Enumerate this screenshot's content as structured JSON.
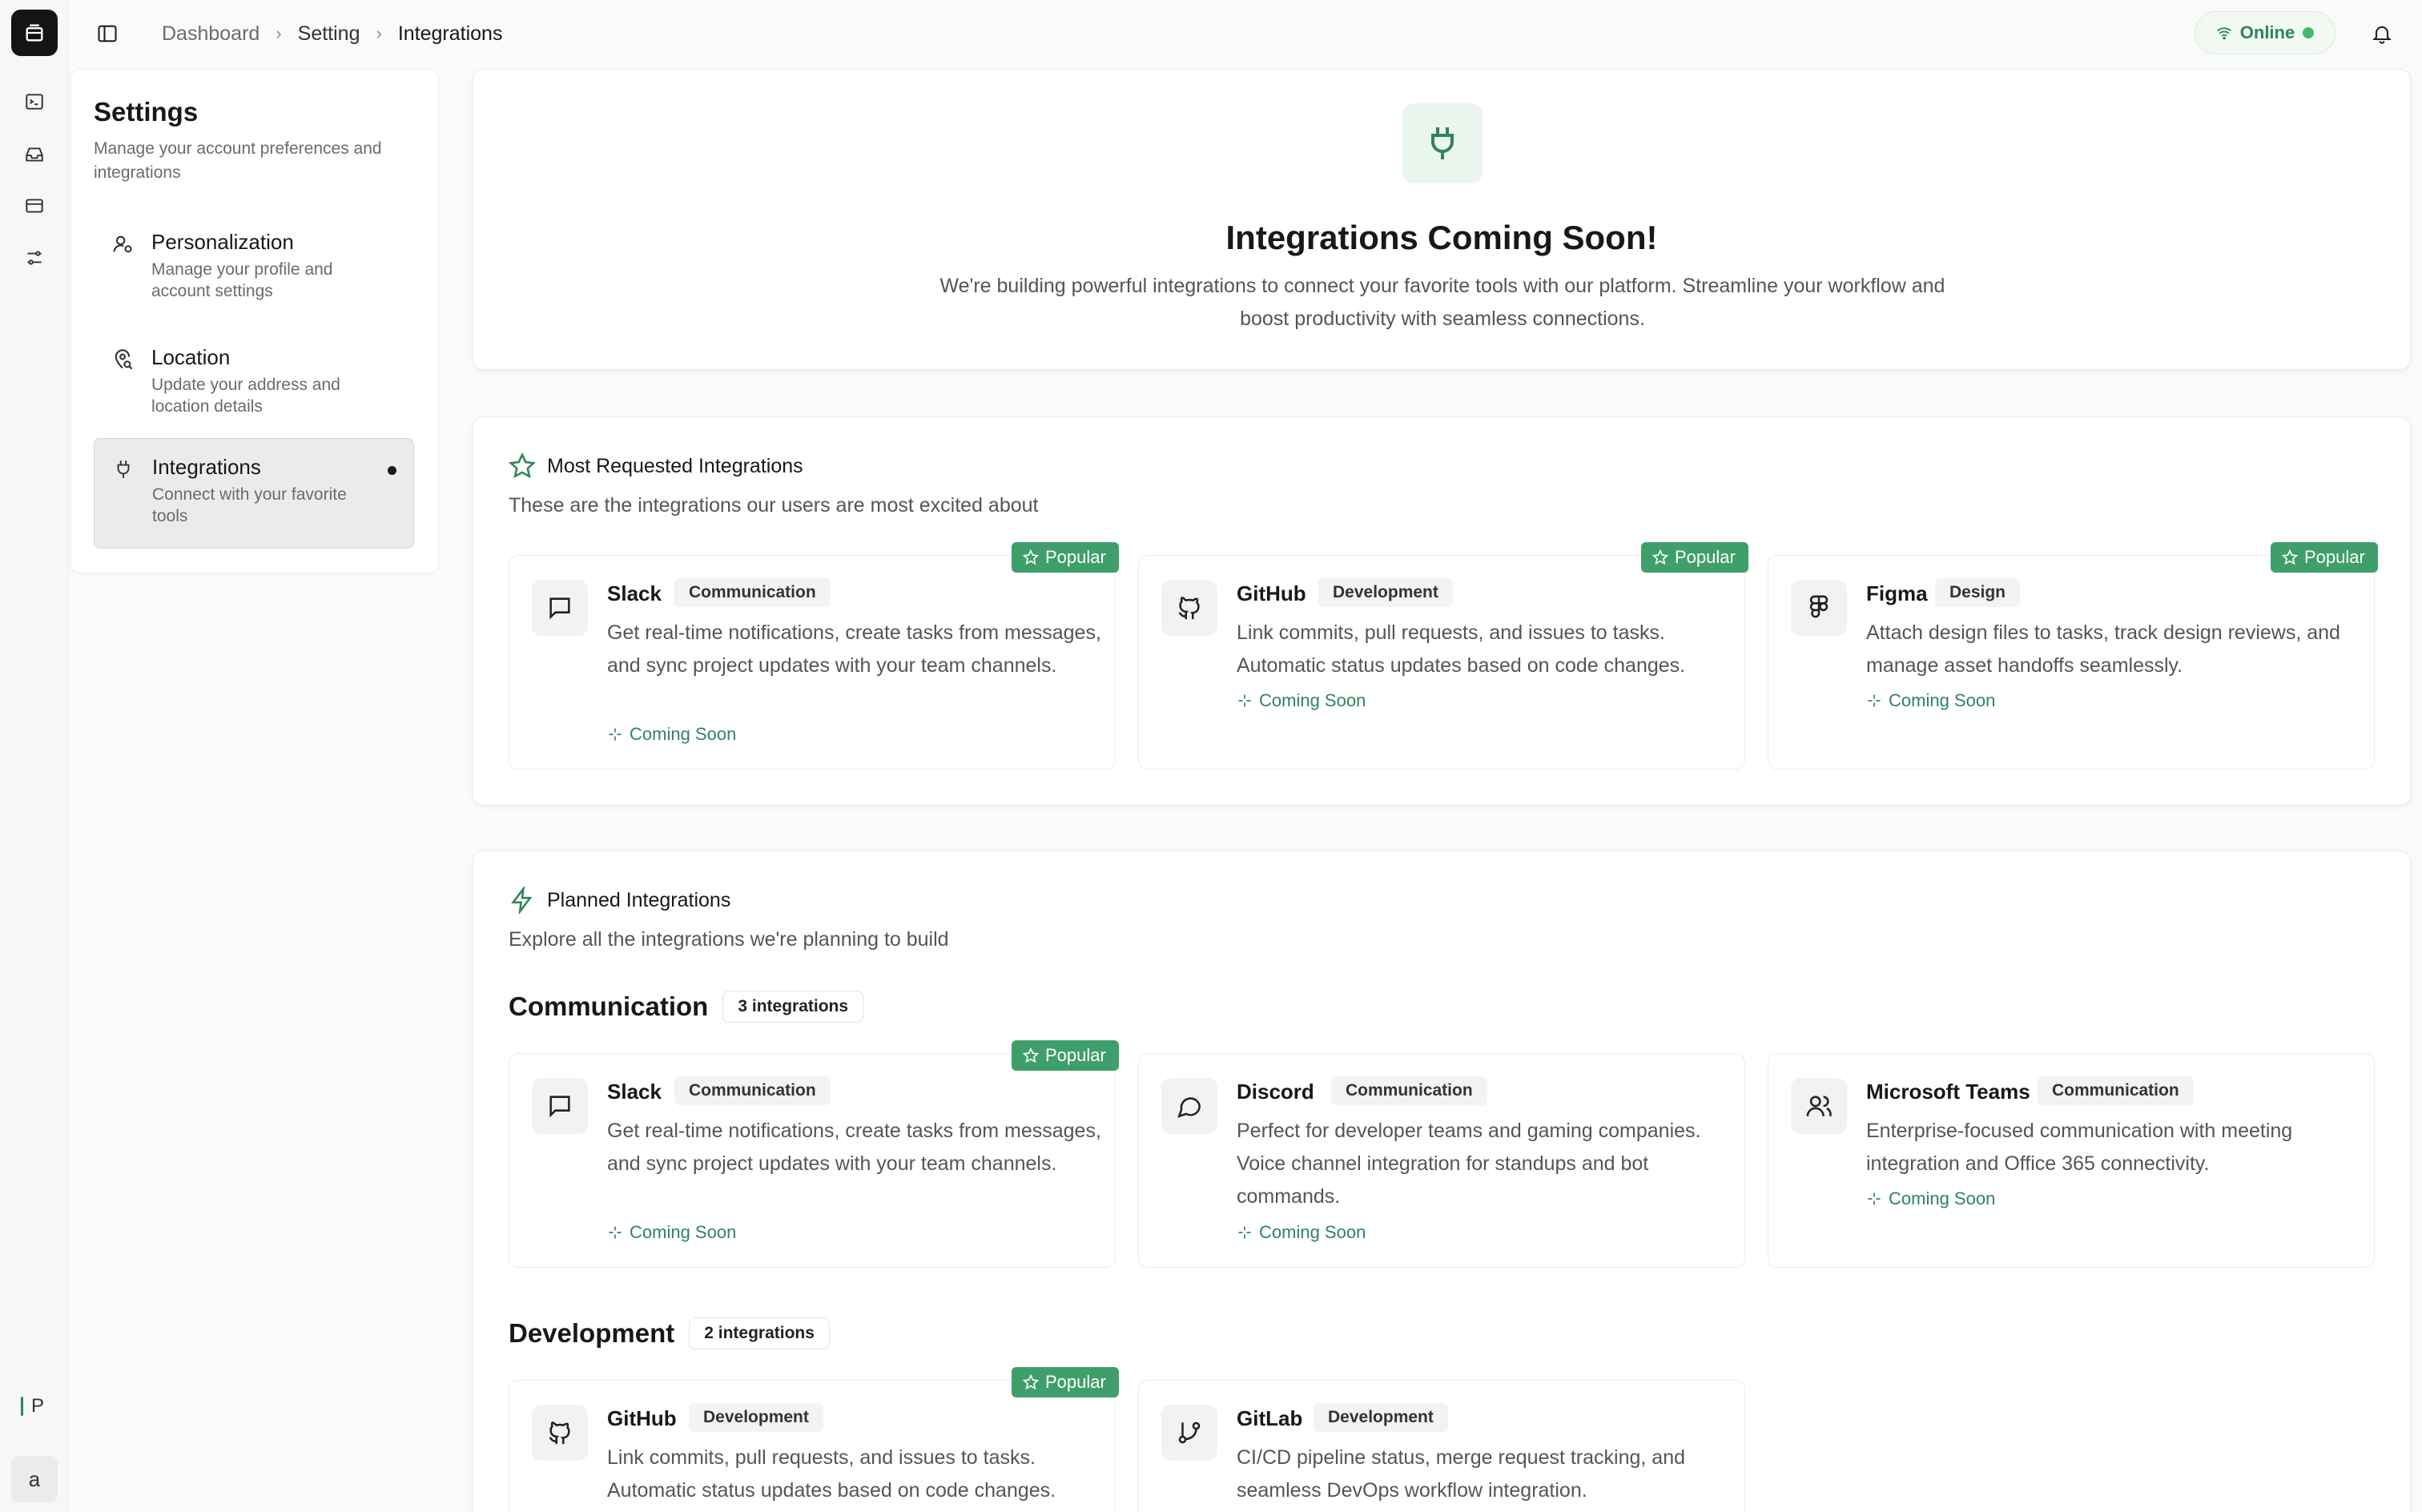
{
  "breadcrumb": [
    "Dashboard",
    "Setting",
    "Integrations"
  ],
  "status": {
    "label": "Online",
    "color": "#3fb96c"
  },
  "rail": {
    "icons": [
      "terminal-icon",
      "inbox-icon",
      "credit-card-icon",
      "sliders-icon"
    ],
    "p_label": "P",
    "avatar_label": "a"
  },
  "settings": {
    "title": "Settings",
    "subtitle": "Manage your account preferences and integrations",
    "items": [
      {
        "title": "Personalization",
        "desc": "Manage your profile and account settings",
        "icon": "user-cog-icon"
      },
      {
        "title": "Location",
        "desc": "Update your address and location details",
        "icon": "map-pin-search-icon"
      },
      {
        "title": "Integrations",
        "desc": "Connect with your favorite tools",
        "icon": "plug-icon",
        "active": true
      }
    ]
  },
  "hero": {
    "title": "Integrations Coming Soon!",
    "text": "We're building powerful integrations to connect your favorite tools with our platform. Streamline your workflow and boost productivity with seamless connections."
  },
  "requested": {
    "title": "Most Requested Integrations",
    "subtitle": "These are the integrations our users are most excited about",
    "cards": [
      {
        "name": "Slack",
        "tag": "Communication",
        "desc": "Get real-time notifications, create tasks from messages, and sync project updates with your team channels.",
        "soon": "Coming Soon",
        "popular": "Popular"
      },
      {
        "name": "GitHub",
        "tag": "Development",
        "desc": "Link commits, pull requests, and issues to tasks. Automatic status updates based on code changes.",
        "soon": "Coming Soon",
        "popular": "Popular"
      },
      {
        "name": "Figma",
        "tag": "Design",
        "desc": "Attach design files to tasks, track design reviews, and manage asset handoffs seamlessly.",
        "soon": "Coming Soon",
        "popular": "Popular"
      }
    ]
  },
  "planned": {
    "title": "Planned Integrations",
    "subtitle": "Explore all the integrations we're planning to build",
    "groups": [
      {
        "name": "Communication",
        "count": "3 integrations",
        "cards": [
          {
            "name": "Slack",
            "tag": "Communication",
            "desc": "Get real-time notifications, create tasks from messages, and sync project updates with your team channels.",
            "soon": "Coming Soon",
            "popular": "Popular"
          },
          {
            "name": "Discord",
            "tag": "Communication",
            "desc": "Perfect for developer teams and gaming companies. Voice channel integration for standups and bot commands.",
            "soon": "Coming Soon"
          },
          {
            "name": "Microsoft Teams",
            "tag": "Communication",
            "desc": "Enterprise-focused communication with meeting integration and Office 365 connectivity.",
            "soon": "Coming Soon"
          }
        ]
      },
      {
        "name": "Development",
        "count": "2 integrations",
        "cards": [
          {
            "name": "GitHub",
            "tag": "Development",
            "desc": "Link commits, pull requests, and issues to tasks. Automatic status updates based on code changes.",
            "popular": "Popular"
          },
          {
            "name": "GitLab",
            "tag": "Development",
            "desc": "CI/CD pipeline status, merge request tracking, and seamless DevOps workflow integration."
          }
        ]
      }
    ]
  },
  "colors": {
    "accent": "#2f855a",
    "popular_bg": "#3f9f6a",
    "online_dot": "#3fb96c"
  }
}
